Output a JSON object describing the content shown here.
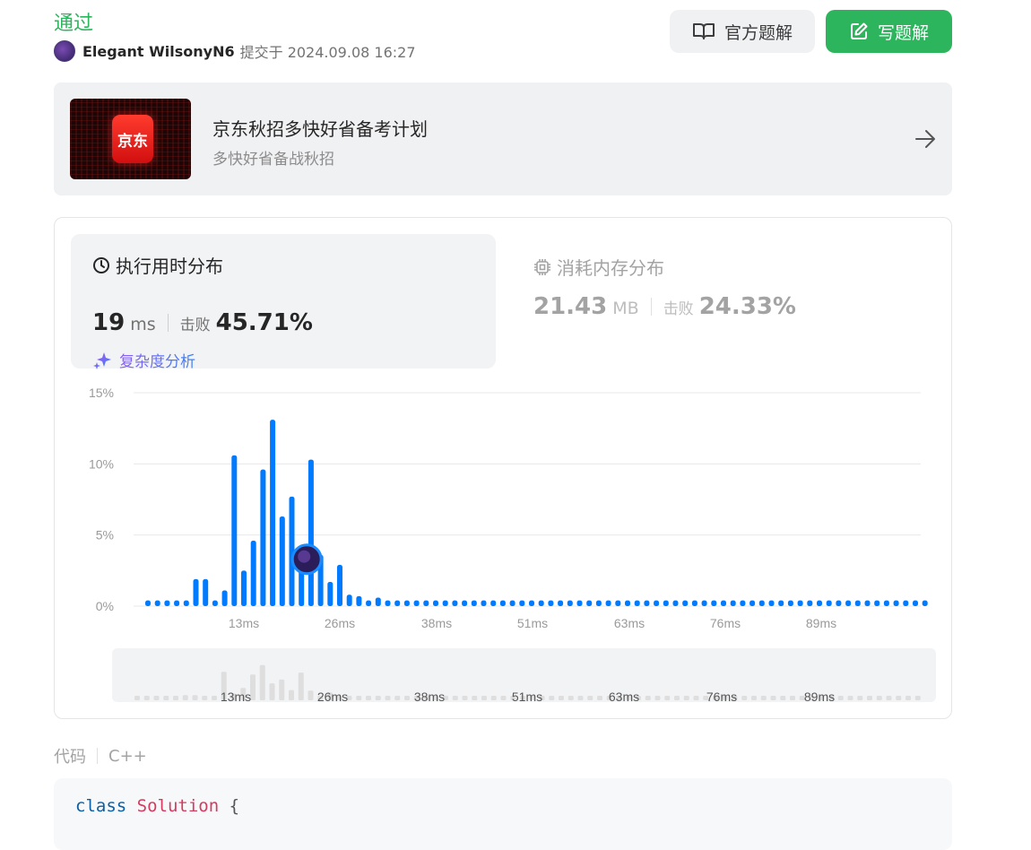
{
  "header": {
    "status": "通过",
    "author": "Elegant WilsonyN6",
    "submitted": "提交于 2024.09.08 16:27",
    "official_solution": "官方题解",
    "write_solution": "写题解"
  },
  "banner": {
    "logo_text": "京东",
    "title": "京东秋招多快好省备考计划",
    "subtitle": "多快好省备战秋招"
  },
  "runtime": {
    "title": "执行用时分布",
    "value": "19",
    "unit": "ms",
    "beats_label": "击败",
    "beats": "45.71%",
    "complexity_link": "复杂度分析"
  },
  "memory": {
    "title": "消耗内存分布",
    "value": "21.43",
    "unit": "MB",
    "beats_label": "击败",
    "beats": "24.33%"
  },
  "colors": {
    "accent_green": "#2db55d",
    "bar_blue": "#007aff",
    "marker": "#2b1d5a"
  },
  "chart_data": {
    "type": "bar",
    "y_tick_labels": [
      "15%",
      "10%",
      "5%",
      "0%"
    ],
    "yticks": [
      15,
      10,
      5,
      0
    ],
    "ylim": [
      0,
      15
    ],
    "x_tick_labels": [
      "13ms",
      "26ms",
      "38ms",
      "51ms",
      "63ms",
      "76ms",
      "89ms"
    ],
    "grid": true,
    "highlight_bar_index": 16,
    "series": [
      {
        "values": [
          0.4,
          0.4,
          0.4,
          0.4,
          0.4,
          1.9,
          1.9,
          0.4,
          1.1,
          10.6,
          2.5,
          4.6,
          9.6,
          13.1,
          6.3,
          7.7,
          3.8,
          10.3,
          3.6,
          1.7,
          2.9,
          0.8,
          0.7,
          0.4,
          0.6,
          0.4,
          0.4,
          0.4,
          0.4,
          0.4,
          0.4,
          0.4,
          0.4,
          0.4,
          0.4,
          0.4,
          0.4,
          0.4,
          0.4,
          0.4,
          0.4,
          0.4,
          0.4,
          0.4,
          0.4,
          0.4,
          0.4,
          0.4,
          0.4,
          0.4,
          0.4,
          0.4,
          0.4,
          0.4,
          0.4,
          0.4,
          0.4,
          0.4,
          0.4,
          0.4,
          0.4,
          0.4,
          0.4,
          0.4,
          0.4,
          0.4,
          0.4,
          0.4,
          0.4,
          0.4,
          0.4,
          0.4,
          0.4,
          0.4,
          0.4,
          0.4,
          0.4,
          0.4,
          0.4,
          0.4,
          0.4,
          0.4
        ]
      }
    ]
  },
  "code": {
    "label": "代码",
    "language": "C++",
    "line1": {
      "keyword": "class",
      "name": "Solution",
      "brace": "{"
    }
  }
}
